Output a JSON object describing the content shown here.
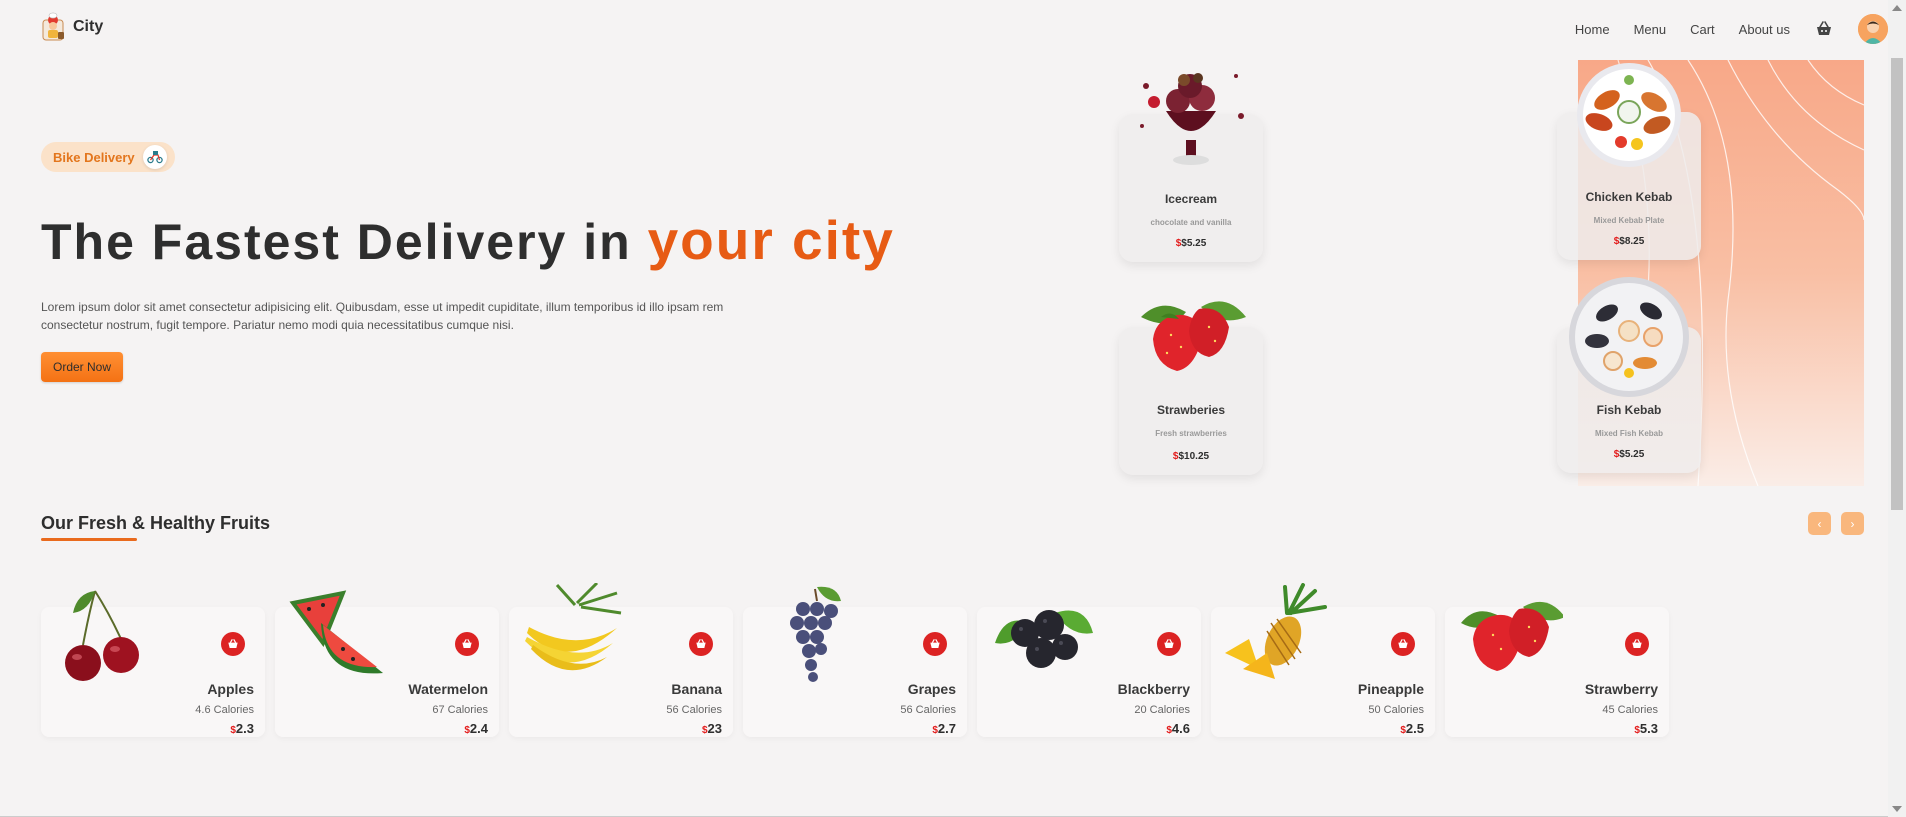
{
  "header": {
    "logo_text": "City",
    "nav": [
      "Home",
      "Menu",
      "Cart",
      "About us"
    ],
    "cart_icon": "basket-icon",
    "avatar_icon": "user-avatar"
  },
  "hero": {
    "badge_text": "Bike Delivery",
    "title_main": "The Fastest Delivery in",
    "title_accent": "your city",
    "description": "Lorem ipsum dolor sit amet consectetur adipisicing elit. Quibusdam, esse ut impedit cupiditate, illum temporibus id illo ipsam rem consectetur nostrum, fugit tempore. Pariatur nemo modi quia necessitatibus cumque nisi.",
    "cta": "Order Now"
  },
  "featured": [
    {
      "name": "Icecream",
      "sub": "chocolate and vanilla",
      "price": "$5.25"
    },
    {
      "name": "Chicken Kebab",
      "sub": "Mixed Kebab Plate",
      "price": "$8.25"
    },
    {
      "name": "Strawberies",
      "sub": "Fresh strawberries",
      "price": "$10.25"
    },
    {
      "name": "Fish Kebab",
      "sub": "Mixed Fish Kebab",
      "price": "$5.25"
    }
  ],
  "fruits_section": {
    "title": "Our Fresh & Healthy Fruits",
    "prev_icon": "chevron-left-icon",
    "next_icon": "chevron-right-icon",
    "items": [
      {
        "name": "Apples",
        "calories": "4.6 Calories",
        "price": "2.3"
      },
      {
        "name": "Watermelon",
        "calories": "67 Calories",
        "price": "2.4"
      },
      {
        "name": "Banana",
        "calories": "56 Calories",
        "price": "23"
      },
      {
        "name": "Grapes",
        "calories": "56 Calories",
        "price": "2.7"
      },
      {
        "name": "Blackberry",
        "calories": "20 Calories",
        "price": "4.6"
      },
      {
        "name": "Pineapple",
        "calories": "50 Calories",
        "price": "2.5"
      },
      {
        "name": "Strawberry",
        "calories": "45 Calories",
        "price": "5.3"
      }
    ]
  },
  "currency_symbol": "$",
  "colors": {
    "accent": "#e75b14",
    "button": "#f47214",
    "add_button": "#dc2323",
    "badge_bg": "#fbe2c9"
  }
}
